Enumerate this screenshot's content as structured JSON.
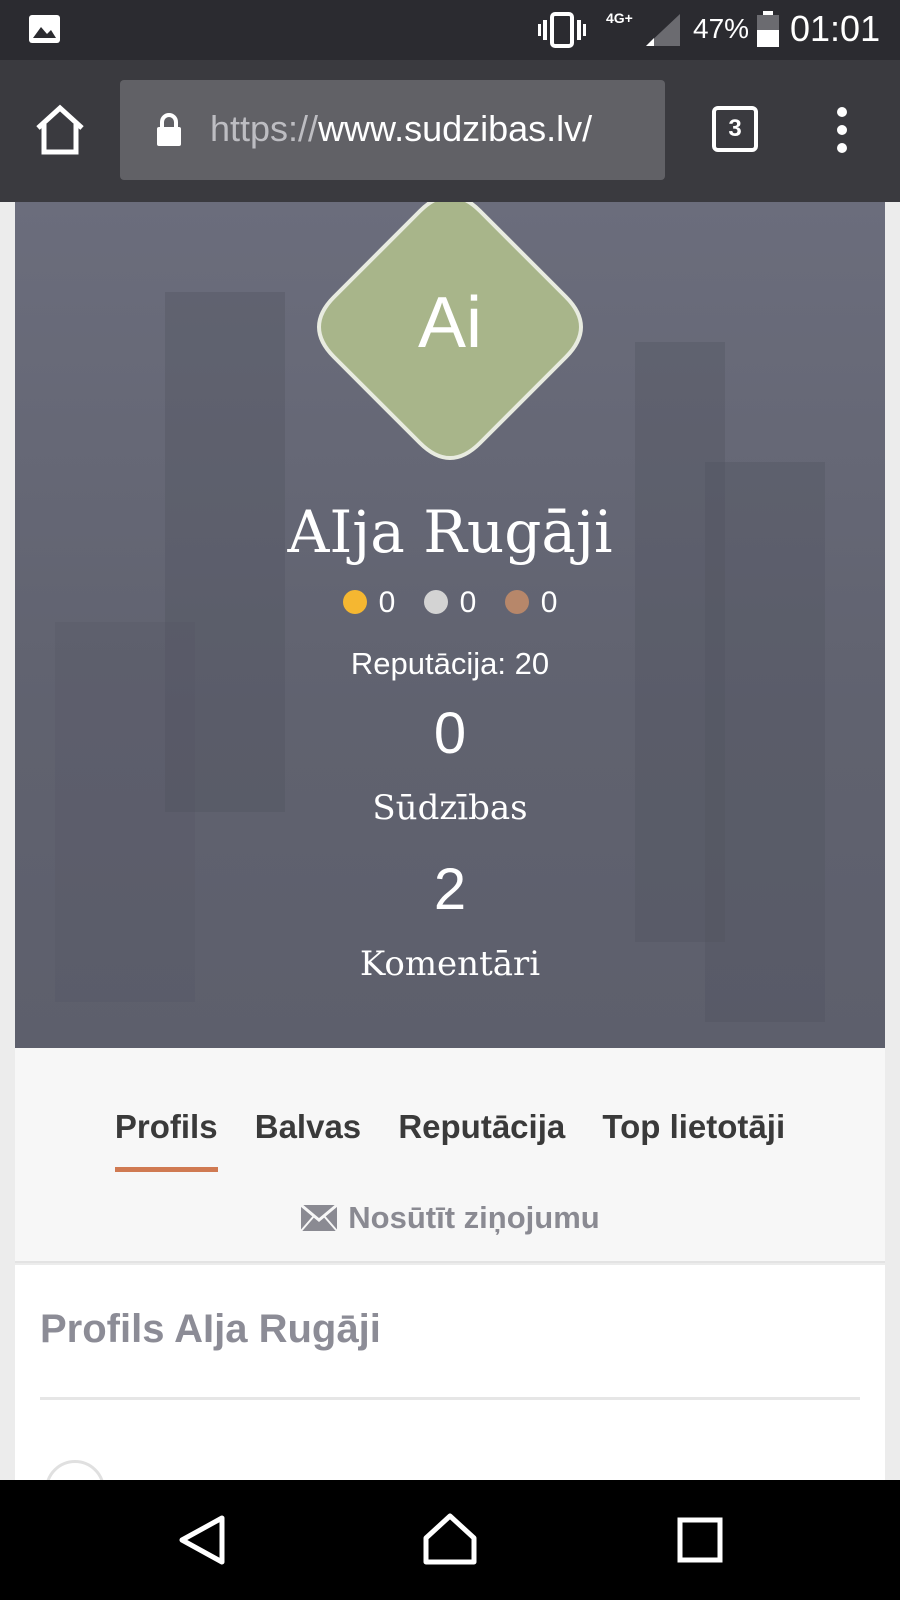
{
  "status_bar": {
    "network": "4G+",
    "battery_percent": "47%",
    "time": "01:01",
    "icons": [
      "gallery-icon",
      "vibrate-icon",
      "signal-icon",
      "battery-icon"
    ]
  },
  "browser": {
    "url_scheme": "https://",
    "url_host": "www.sudzibas.lv/",
    "tab_count": "3",
    "icons": [
      "home-icon",
      "lock-icon",
      "tabs-icon",
      "overflow-menu-icon"
    ]
  },
  "profile": {
    "avatar_initials": "Ai",
    "avatar_color": "#a8b58a",
    "name": "AIja Rugāji",
    "medals": [
      {
        "color": "#f5b731",
        "count": "0"
      },
      {
        "color": "#d3d3d3",
        "count": "0"
      },
      {
        "color": "#b7876a",
        "count": "0"
      }
    ],
    "reputation": "Reputācija: 20",
    "stats": [
      {
        "value": "0",
        "label": "Sūdzības"
      },
      {
        "value": "2",
        "label": "Komentāri"
      }
    ]
  },
  "tabs": {
    "items": [
      {
        "label": "Profils",
        "active": true
      },
      {
        "label": "Balvas",
        "active": false
      },
      {
        "label": "Reputācija",
        "active": false
      },
      {
        "label": "Top lietotāji",
        "active": false
      }
    ],
    "accent_color": "#d07a52",
    "send_message": "Nosūtīt ziņojumu"
  },
  "content": {
    "title": "Profils AIja Rugāji"
  },
  "nav_bar": {
    "icons": [
      "back-icon",
      "home-icon",
      "recents-icon"
    ]
  }
}
